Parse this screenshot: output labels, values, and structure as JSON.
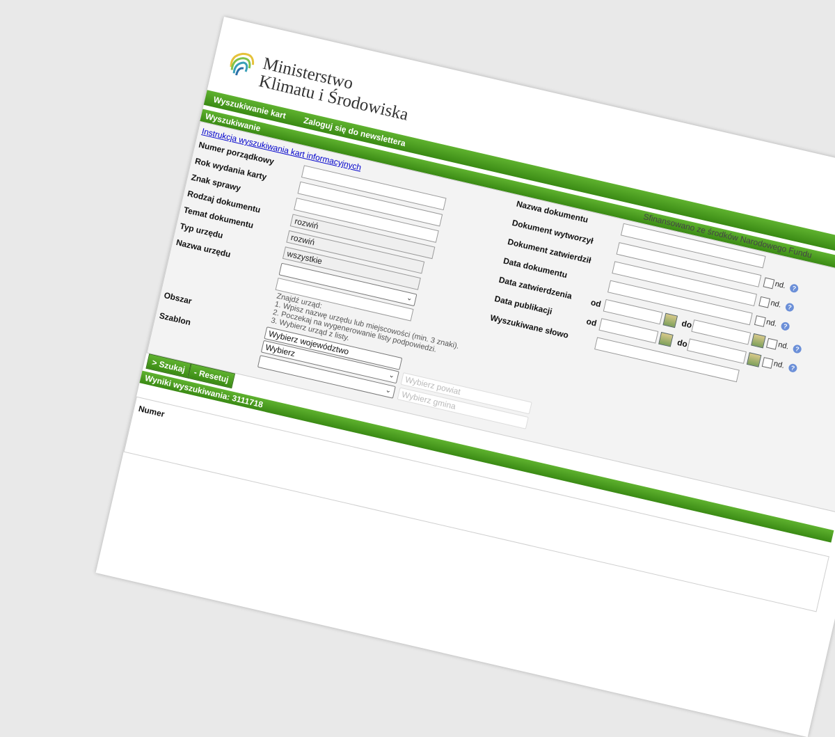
{
  "brand": {
    "line1": "Ministerstwo",
    "line2": "Klimatu i Środowiska"
  },
  "topnav": {
    "item1": "Wyszukiwanie kart",
    "item2": "Zaloguj się do newslettera"
  },
  "funded": {
    "line1": "Sfinansowano ze środków Narodowego Fundu",
    "line2": "Ochrony Środowiska i Gospodarki Wodnej"
  },
  "search": {
    "title": "Wyszukiwanie",
    "instructions_link": "Instrukcja wyszukiwania kart informacyjnych",
    "labels": {
      "numer": "Numer porządkowy",
      "rok": "Rok wydania karty",
      "znak": "Znak sprawy",
      "rodzaj": "Rodzaj dokumentu",
      "temat": "Temat dokumentu",
      "typ": "Typ urzędu",
      "nazwa_urzedu": "Nazwa urzędu",
      "obszar": "Obszar",
      "szablon": "Szablon",
      "nazwa_dok": "Nazwa dokumentu",
      "wytworzyl": "Dokument wytworzył",
      "zatwierdzil": "Dokument zatwierdził",
      "data_dok": "Data dokumentu",
      "data_zatw": "Data zatwierdzenia",
      "data_pub": "Data publikacji",
      "slowo": "Wyszukiwane słowo"
    },
    "values": {
      "rodzaj": "rozwiń",
      "temat": "rozwiń",
      "typ": "wszystkie"
    },
    "hint": {
      "line1": "Znajdź urząd:",
      "line2": "1. Wpisz nazwę urzędu lub miejscowości (min. 3 znaki).",
      "line3": "2. Poczekaj na wygenerowanie listy podpowiedzi.",
      "line4": "3. Wybierz urząd z listy."
    },
    "obszar": {
      "wojewodztwo": "Wybierz województwo",
      "powiat": "Wybierz powiat",
      "gmina": "Wybierz gmina"
    },
    "szablon": "Wybierz",
    "nd_label": "nd.",
    "od": "od",
    "do": "do",
    "buttons": {
      "search": "> Szukaj",
      "reset": "- Resetuj"
    }
  },
  "results": {
    "title": "Wyniki wyszukiwania: 3111718",
    "col_numer": "Numer"
  },
  "colors": {
    "green": "#4a9a1f",
    "link": "#0000cc"
  }
}
